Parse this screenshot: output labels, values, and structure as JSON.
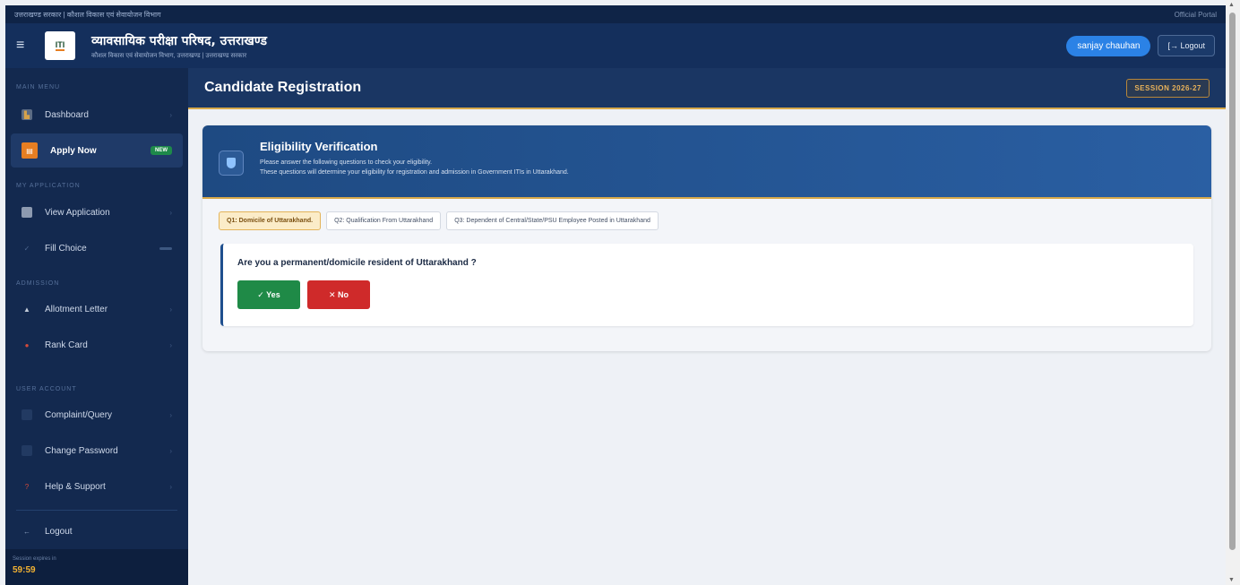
{
  "topstrip": {
    "left": "उत्तराखण्ड सरकार  |  कौशल विकास एवं सेवायोजन विभाग",
    "right": "Official Portal"
  },
  "header": {
    "logo": "ITI",
    "title": "व्यावसायिक परीक्षा परिषद, उत्तराखण्ड",
    "subtitle": "कौशल विकास एवं सेवायोजन विभाग, उत्तराखण्ड | उत्तराखण्ड सरकार",
    "user": "sanjay chauhan",
    "logout": "[→ Logout"
  },
  "sidebar": {
    "sections": {
      "main_menu": "MAIN MENU",
      "my_application": "MY APPLICATION",
      "admission": "ADMISSION",
      "user_account": "USER ACCOUNT"
    },
    "items": {
      "dashboard": "Dashboard",
      "apply_now": "Apply Now",
      "apply_badge": "NEW",
      "view_application": "View Application",
      "fill_choice": "Fill Choice",
      "allotment_letter": "Allotment Letter",
      "rank_card": "Rank Card",
      "complaint": "Complaint/Query",
      "change_password": "Change Password",
      "help": "Help & Support",
      "logout": "Logout"
    },
    "session_label": "Session expires in",
    "session_time": "59:59"
  },
  "page": {
    "title": "Candidate Registration",
    "session": "SESSION 2026-27"
  },
  "card": {
    "heading": "Eligibility Verification",
    "desc1": "Please answer the following questions to check your eligibility.",
    "desc2": "These questions will determine your eligibility for registration and admission in Government ITIs in Uttarakhand.",
    "tabs": [
      "Q1: Domicile of Uttarakhand.",
      "Q2: Qualification From Uttarakhand",
      "Q3: Dependent of Central/State/PSU Employee Posted in Uttarakhand"
    ],
    "question": "Are you a permanent/domicile resident of Uttarakhand ?",
    "yes": "✓ Yes",
    "no": "✕ No"
  },
  "colors": {
    "navy": "#142f5c",
    "accent_orange": "#e67e22",
    "gold": "#d8a94a",
    "yes_green": "#1f8a47",
    "no_red": "#cf2a2a",
    "user_blue": "#2b82e6"
  }
}
